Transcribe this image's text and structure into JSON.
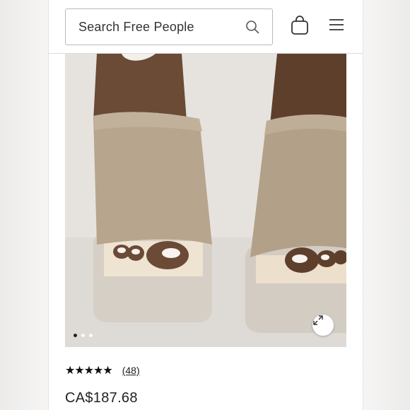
{
  "header": {
    "search": {
      "placeholder": "Search Free People",
      "icon": "search-icon"
    },
    "bag": {
      "icon": "shopping-bag-icon"
    },
    "menu": {
      "icon": "hamburger-menu-icon"
    }
  },
  "product": {
    "image": {
      "description_icon": "product-image",
      "carousel": {
        "total": 3,
        "active_index": 0
      },
      "zoom": {
        "icon": "expand-icon"
      }
    },
    "rating": {
      "stars_display": "★★★★★",
      "value": 4.5,
      "max": 5,
      "review_count": "(48)"
    },
    "price": "CA$187.68"
  },
  "colors": {
    "text": "#222222",
    "border": "#b9b9b9"
  }
}
